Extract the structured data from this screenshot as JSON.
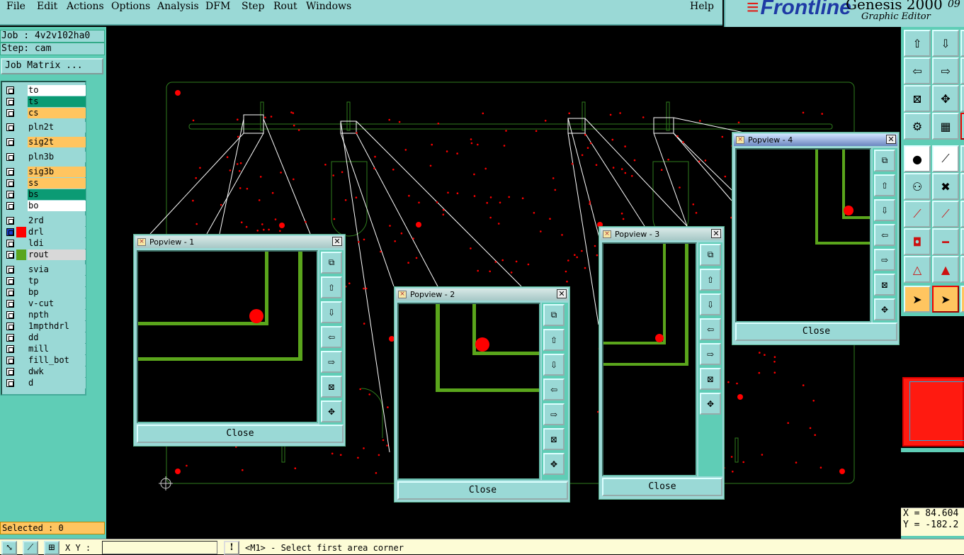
{
  "menubar": {
    "items": [
      "File",
      "Edit",
      "Actions",
      "Options",
      "Analysis",
      "DFM",
      "Step",
      "Rout",
      "Windows"
    ],
    "help": "Help"
  },
  "brand": {
    "logo": "Frontline",
    "product": "Genesis 2000",
    "subtitle": "Graphic Editor",
    "version_fragment": "09"
  },
  "job": {
    "job_label": "Job : 4v2v102ha0",
    "step_label": "Step: cam",
    "matrix_button": "Job Matrix ..."
  },
  "layers": [
    {
      "name": "to",
      "bg": "#ffffff",
      "color": ""
    },
    {
      "name": "ts",
      "bg": "#0b9b74",
      "color": ""
    },
    {
      "name": "cs",
      "bg": "#ffc560",
      "color": ""
    },
    {
      "name": "pln2t",
      "bg": "#9ad9d6",
      "color": ""
    },
    {
      "name": "sig2t",
      "bg": "#ffc560",
      "color": ""
    },
    {
      "name": "pln3b",
      "bg": "#9ad9d6",
      "color": ""
    },
    {
      "name": "sig3b",
      "bg": "#ffc560",
      "color": ""
    },
    {
      "name": "ss",
      "bg": "#ffc560",
      "color": ""
    },
    {
      "name": "bs",
      "bg": "#0b9b74",
      "color": ""
    },
    {
      "name": "bo",
      "bg": "#ffffff",
      "color": ""
    },
    {
      "name": "2rd",
      "bg": "#9ad9d6",
      "color": ""
    },
    {
      "name": "drl",
      "bg": "#9ad9d6",
      "color": "#ff0000",
      "work": true
    },
    {
      "name": "ldi",
      "bg": "#9ad9d6",
      "color": ""
    },
    {
      "name": "rout",
      "bg": "#d8d8d8",
      "color": "#5aa51c"
    },
    {
      "name": "svia",
      "bg": "#9ad9d6",
      "color": ""
    },
    {
      "name": "tp",
      "bg": "#9ad9d6",
      "color": ""
    },
    {
      "name": "bp",
      "bg": "#9ad9d6",
      "color": ""
    },
    {
      "name": "v-cut",
      "bg": "#9ad9d6",
      "color": ""
    },
    {
      "name": "npth",
      "bg": "#9ad9d6",
      "color": ""
    },
    {
      "name": "1mpthdrl",
      "bg": "#9ad9d6",
      "color": ""
    },
    {
      "name": "dd",
      "bg": "#9ad9d6",
      "color": ""
    },
    {
      "name": "mill",
      "bg": "#9ad9d6",
      "color": ""
    },
    {
      "name": "fill_bot",
      "bg": "#9ad9d6",
      "color": ""
    },
    {
      "name": "dwk",
      "bg": "#9ad9d6",
      "color": ""
    },
    {
      "name": "d",
      "bg": "#9ad9d6",
      "color": ""
    }
  ],
  "status": {
    "selected": "Selected : 0",
    "xy_label": "X Y :",
    "xy_value": "",
    "warning": "!",
    "prompt": "<M1> - Select first area corner",
    "x_readout": "X = 84.604",
    "y_readout": "Y = -182.2"
  },
  "popviews": [
    {
      "title": "Popview - 1",
      "close": "Close"
    },
    {
      "title": "Popview - 2",
      "close": "Close"
    },
    {
      "title": "Popview - 3",
      "close": "Close"
    },
    {
      "title": "Popview - 4",
      "close": "Close"
    }
  ],
  "colors": {
    "panel": "#9ad9d6",
    "panel_dark": "#5fcdb6",
    "highlight": "#ffc560",
    "trace": "#5aa51c",
    "pad": "#ff0000",
    "outline": "#2f7d1e"
  },
  "icons": {
    "popview_side": [
      "zoom-fit-icon",
      "pan-up-icon",
      "pan-down-icon",
      "pan-left-icon",
      "pan-right-icon",
      "zoom-in-icon",
      "zoom-out-icon"
    ]
  }
}
